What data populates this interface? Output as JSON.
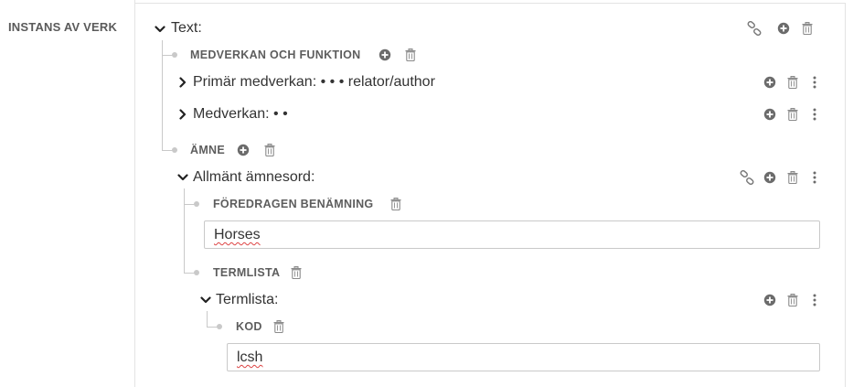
{
  "left": {
    "label": "INSTANS AV VERK"
  },
  "root": {
    "title": "Text:"
  },
  "medverkan_funktion": {
    "label": "MEDVERKAN OCH FUNKTION"
  },
  "primar": {
    "title": "Primär medverkan: • • • relator/author"
  },
  "medverkan": {
    "title": "Medverkan: • •"
  },
  "amne": {
    "label": "ÄMNE"
  },
  "allmant": {
    "title": "Allmänt ämnesord:"
  },
  "foredragen": {
    "label": "FÖREDRAGEN BENÄMNING",
    "value": "Horses"
  },
  "termlista_prop": {
    "label": "TERMLISTA"
  },
  "termlista": {
    "title": "Termlista:"
  },
  "kod": {
    "label": "KOD",
    "value": "lcsh"
  },
  "icons": {
    "link": "link-icon",
    "add": "plus-circle-icon",
    "delete": "trash-icon",
    "more": "kebab-menu-icon",
    "expand": "chevron-right-icon",
    "collapse": "chevron-down-icon"
  },
  "colors": {
    "icon": "#6b6b6b",
    "line": "#c9c9c9",
    "text": "#333333"
  }
}
